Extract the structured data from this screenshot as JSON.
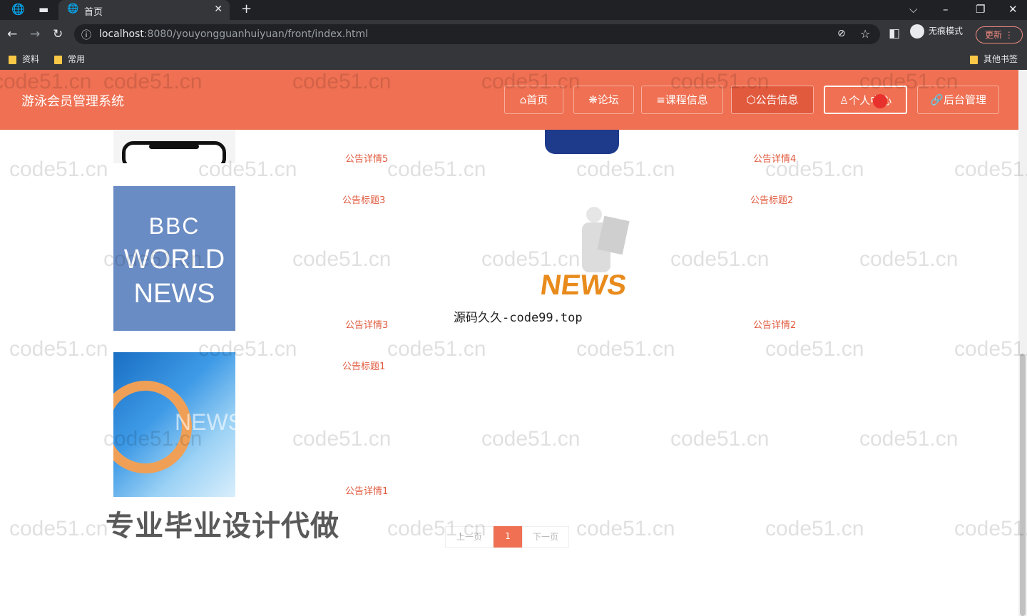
{
  "browser": {
    "tab_title": "首页",
    "url_host": "localhost",
    "url_rest": ":8080/youyongguanhuiyuan/front/index.html",
    "incognito_label": "无痕模式",
    "update_label": "更新",
    "bookmarks": [
      "资料",
      "常用"
    ],
    "other_bookmarks": "其他书签"
  },
  "site": {
    "title": "游泳会员管理系统",
    "nav": [
      {
        "label": "首页",
        "icon": "home-icon"
      },
      {
        "label": "论坛",
        "icon": "gear-icon"
      },
      {
        "label": "课程信息",
        "icon": "list-icon"
      },
      {
        "label": "公告信息",
        "icon": "box-icon"
      },
      {
        "label": "个人中心",
        "icon": "user-icon"
      },
      {
        "label": "后台管理",
        "icon": "link-icon"
      }
    ],
    "accent_color": "#ef7052"
  },
  "announcements": [
    {
      "detail": "公告详情5"
    },
    {
      "detail": "公告详情4"
    },
    {
      "title": "公告标题3",
      "detail": "公告详情3",
      "image_text": [
        "BBC",
        "WORLD",
        "NEWS"
      ]
    },
    {
      "title": "公告标题2",
      "detail": "公告详情2",
      "image_text": [
        "NEWS"
      ]
    },
    {
      "title": "公告标题1",
      "detail": "公告详情1",
      "image_text": [
        "NEWS"
      ]
    }
  ],
  "pagination": {
    "prev": "上一页",
    "current": "1",
    "next": "下一页"
  },
  "overlays": {
    "code_text": "源码久久-code99.top",
    "promo_text": "专业毕业设计代做"
  },
  "watermark_text": "code51.cn"
}
